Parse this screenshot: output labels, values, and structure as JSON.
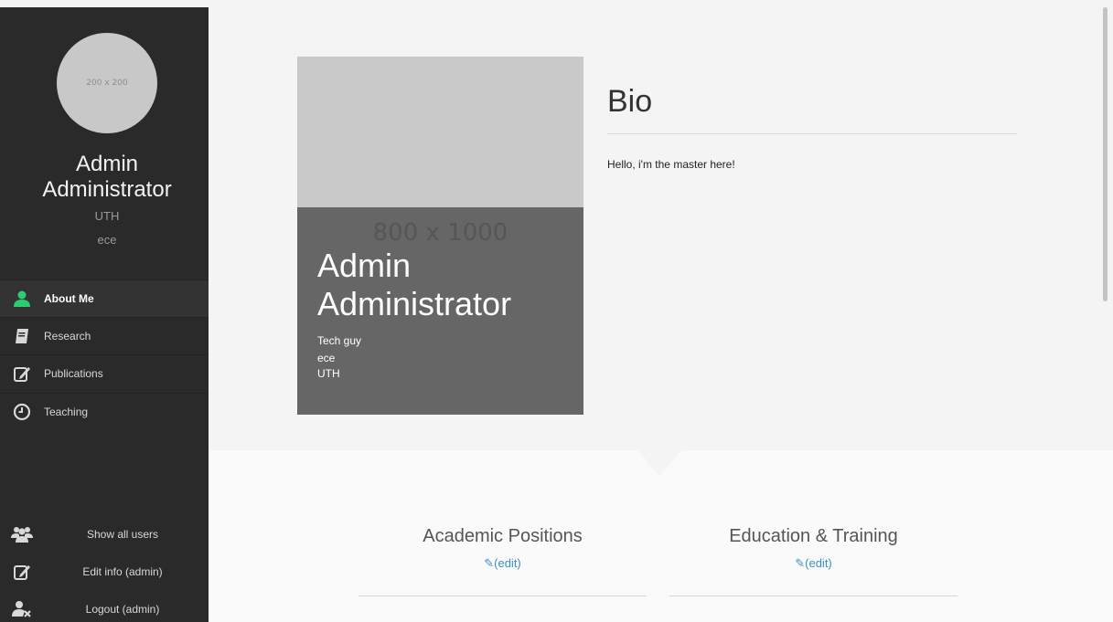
{
  "sidebar": {
    "avatar_placeholder": "200 x 200",
    "name_first": "Admin",
    "name_last": "Administrator",
    "institution": "UTH",
    "department": "ece",
    "nav": [
      {
        "label": "About Me",
        "icon": "user-icon",
        "active": true
      },
      {
        "label": "Research",
        "icon": "book-icon",
        "active": false
      },
      {
        "label": "Publications",
        "icon": "edit-icon",
        "active": false
      },
      {
        "label": "Teaching",
        "icon": "clock-icon",
        "active": false
      }
    ],
    "bottom": [
      {
        "label": "Show all users",
        "icon": "users-icon"
      },
      {
        "label": "Edit info (admin)",
        "icon": "edit-icon"
      },
      {
        "label": "Logout (admin)",
        "icon": "user-remove-icon"
      }
    ]
  },
  "card": {
    "placeholder": "800 x 1000",
    "name_first": "Admin",
    "name_last": "Administrator",
    "role": "Tech guy",
    "department": "ece",
    "institution": "UTH"
  },
  "bio": {
    "title": "Bio",
    "text": "Hello, i'm the master here!"
  },
  "sections": [
    {
      "title": "Academic Positions",
      "edit": "(edit)"
    },
    {
      "title": "Education & Training",
      "edit": "(edit)"
    }
  ],
  "colors": {
    "accent": "#2ecc71",
    "link": "#3a8fc4",
    "sidebar_bg": "#2a2a2a"
  }
}
